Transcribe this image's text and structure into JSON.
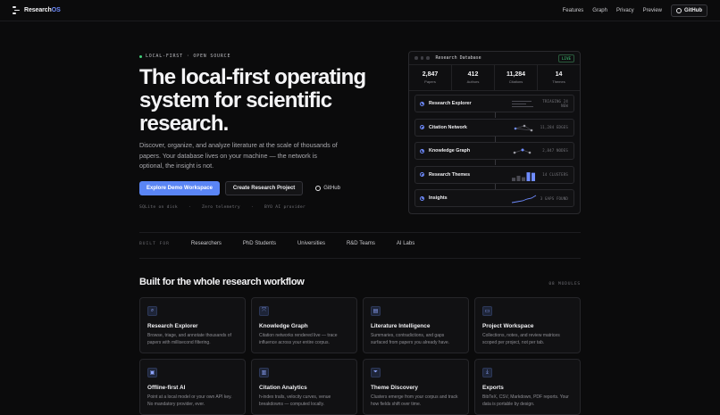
{
  "nav": {
    "brand_main": "Research",
    "brand_accent": "OS",
    "links": [
      "Features",
      "Graph",
      "Privacy",
      "Preview"
    ],
    "github_label": "GitHub"
  },
  "hero": {
    "eyebrow": "LOCAL-FIRST · OPEN SOURCE",
    "title": "The local-first operating system for scientific research.",
    "subtitle": "Discover, organize, and analyze literature at the scale of thousands of papers. Your database lives on your machine — the network is optional, the insight is not.",
    "cta_primary": "Explore Demo Workspace",
    "cta_secondary": "Create Research Project",
    "cta_github": "GitHub",
    "meta": [
      "SQLite on disk",
      "·",
      "Zero telemetry",
      "·",
      "BYO AI provider"
    ]
  },
  "db_card": {
    "title": "Research Database",
    "status": "LIVE",
    "stats": [
      {
        "value": "2,847",
        "label": "Papers"
      },
      {
        "value": "412",
        "label": "Authors"
      },
      {
        "value": "11,284",
        "label": "Citations"
      },
      {
        "value": "14",
        "label": "Themes"
      }
    ],
    "modules": [
      {
        "name": "Research Explorer",
        "meta": "TRIAGING 24 NEW",
        "viz": "lines"
      },
      {
        "name": "Citation Network",
        "meta": "11,284 EDGES",
        "viz": "network"
      },
      {
        "name": "Knowledge Graph",
        "meta": "2,847 NODES",
        "viz": "network"
      },
      {
        "name": "Research Themes",
        "meta": "14 CLUSTERS",
        "viz": "bars",
        "bars": [
          0.35,
          0.55,
          0.4,
          0.9,
          0.85
        ]
      },
      {
        "name": "Insights",
        "meta": "3 GAPS FOUND",
        "viz": "trend"
      }
    ]
  },
  "built_for": {
    "label": "BUILT FOR",
    "items": [
      "Researchers",
      "PhD Students",
      "Universities",
      "R&D Teams",
      "AI Labs"
    ]
  },
  "workflow": {
    "title": "Built for the whole research workflow",
    "count": "08 MODULES",
    "cards": [
      {
        "icon": "search-icon",
        "glyph": "⌕",
        "title": "Research Explorer",
        "desc": "Browse, triage, and annotate thousands of papers with millisecond filtering."
      },
      {
        "icon": "graph-icon",
        "glyph": "⤧",
        "title": "Knowledge Graph",
        "desc": "Citation networks rendered live — trace influence across your entire corpus."
      },
      {
        "icon": "book-icon",
        "glyph": "▤",
        "title": "Literature Intelligence",
        "desc": "Summaries, contradictions, and gaps surfaced from papers you already have."
      },
      {
        "icon": "folder-icon",
        "glyph": "▭",
        "title": "Project Workspace",
        "desc": "Collections, notes, and review matrices scoped per project, not per tab."
      },
      {
        "icon": "chip-icon",
        "glyph": "▣",
        "title": "Offline-first AI",
        "desc": "Point at a local model or your own API key. No mandatory provider, ever."
      },
      {
        "icon": "chart-icon",
        "glyph": "▥",
        "title": "Citation Analytics",
        "desc": "h-index trails, velocity curves, venue breakdowns — computed locally."
      },
      {
        "icon": "filter-icon",
        "glyph": "⏷",
        "title": "Theme Discovery",
        "desc": "Clusters emerge from your corpus and track how fields shift over time."
      },
      {
        "icon": "download-icon",
        "glyph": "⤓",
        "title": "Exports",
        "desc": "BibTeX, CSV, Markdown, PDF reports. Your data is portable by design."
      }
    ]
  },
  "colors": {
    "accent": "#5a85f5",
    "live": "#41d17a",
    "background": "#0b0b0c"
  }
}
